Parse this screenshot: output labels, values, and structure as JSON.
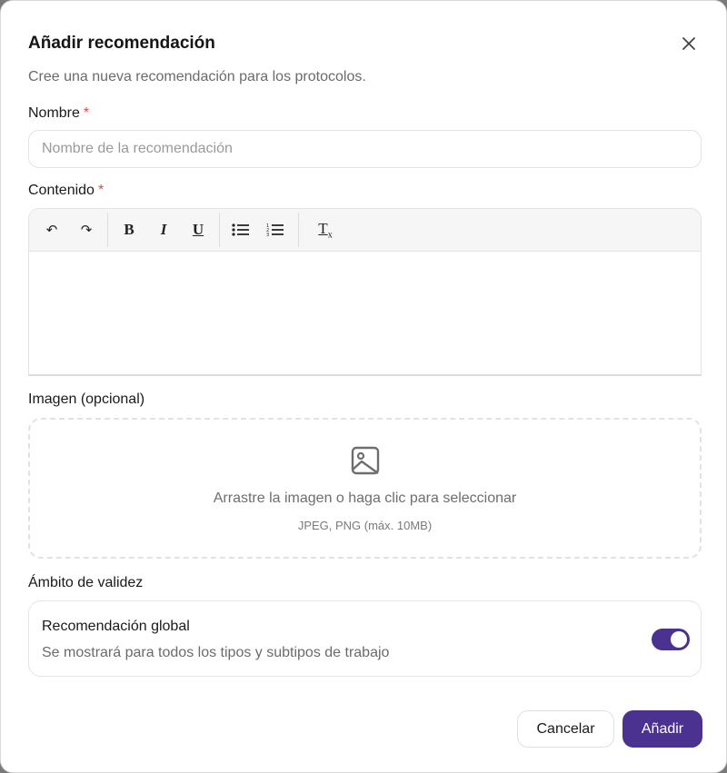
{
  "dialog": {
    "title": "Añadir recomendación",
    "subtitle": "Cree una nueva recomendación para los protocolos."
  },
  "name_field": {
    "label": "Nombre",
    "required_mark": "*",
    "value": "",
    "placeholder": "Nombre de la recomendación"
  },
  "content_field": {
    "label": "Contenido",
    "required_mark": "*",
    "toolbar": {
      "undo": "↶",
      "redo": "↷",
      "bold": "B",
      "italic": "I",
      "underline": "U",
      "bullet_list_icon": "bullet-list-icon",
      "numbered_list_icon": "numbered-list-icon",
      "clear_format": "T",
      "clear_format_sub": "x"
    },
    "value": ""
  },
  "image_field": {
    "label": "Imagen (opcional)",
    "icon": "image-icon",
    "drop_text": "Arrastre la imagen o haga clic para seleccionar",
    "hint": "JPEG, PNG (máx. 10MB)"
  },
  "scope": {
    "label": "Ámbito de validez",
    "title": "Recomendación global",
    "description": "Se mostrará para todos los tipos y subtipos de trabajo",
    "global_enabled": true
  },
  "footer": {
    "cancel_label": "Cancelar",
    "submit_label": "Añadir"
  },
  "colors": {
    "accent": "#4b3190",
    "required": "#e0454a"
  }
}
